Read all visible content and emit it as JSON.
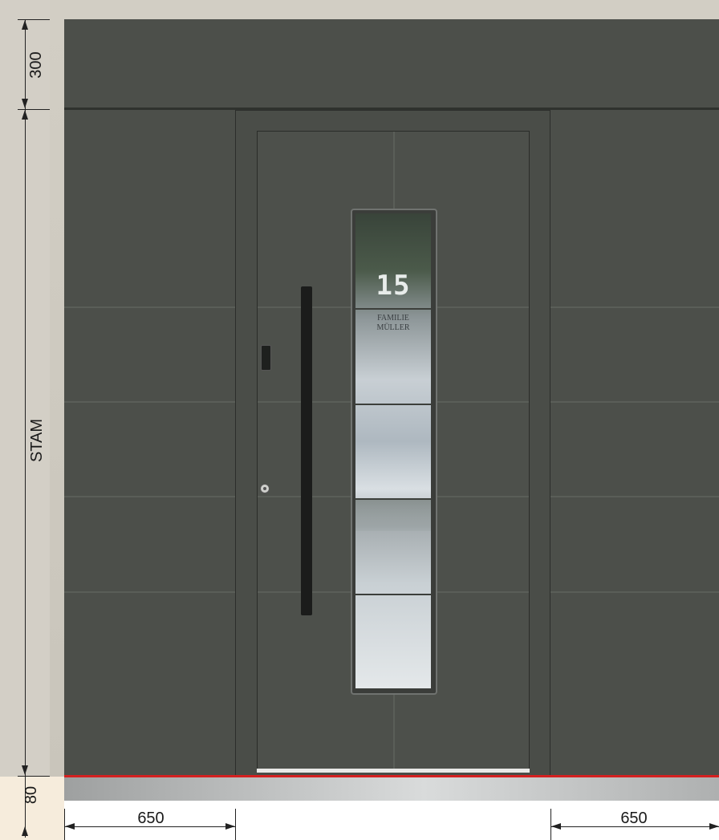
{
  "dimensions": {
    "top_height": "300",
    "frame_height": "STAM",
    "base_height": "80",
    "left_width": "650",
    "right_width": "650"
  },
  "door": {
    "house_number": "15",
    "family_line1": "FAMILIE",
    "family_line2": "MÜLLER"
  },
  "colors": {
    "panel": "#4c4f4a",
    "accent_line": "#d42020",
    "wall": "#d2cec4"
  }
}
